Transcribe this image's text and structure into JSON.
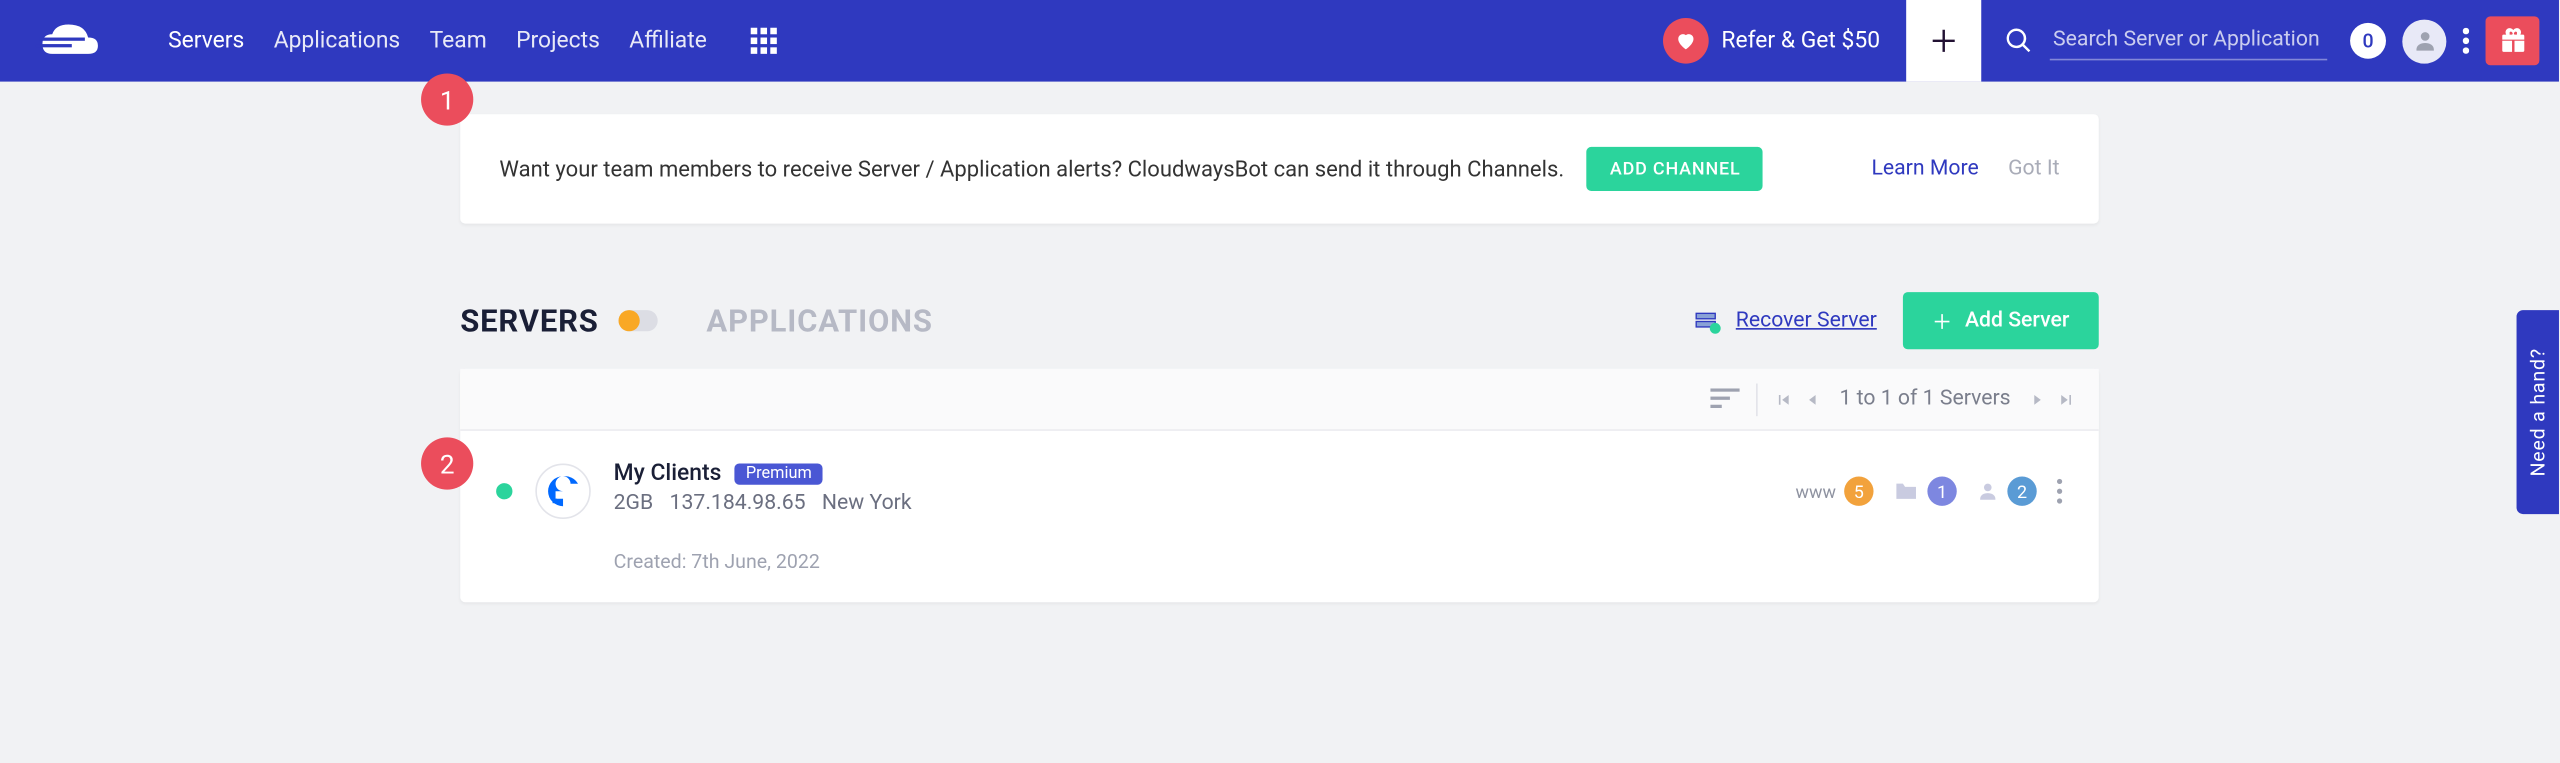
{
  "nav": {
    "items": [
      "Servers",
      "Applications",
      "Team",
      "Projects",
      "Affiliate"
    ],
    "active_index": 0
  },
  "topbar": {
    "refer_label": "Refer & Get $50",
    "search_placeholder": "Search Server or Application",
    "notif_count": "0"
  },
  "steps": {
    "one": "1",
    "two": "2"
  },
  "banner": {
    "text": "Want your team members to receive Server / Application alerts? CloudwaysBot can send it through Channels.",
    "add_channel": "ADD CHANNEL",
    "learn_more": "Learn More",
    "got_it": "Got It"
  },
  "section": {
    "servers_tab": "SERVERS",
    "apps_tab": "APPLICATIONS",
    "recover": "Recover Server",
    "add_server": "Add Server"
  },
  "list": {
    "pager_label": "1 to 1 of 1 Servers"
  },
  "server": {
    "name": "My Clients",
    "badge": "Premium",
    "size": "2GB",
    "ip": "137.184.98.65",
    "region": "New York",
    "created": "Created: 7th June, 2022",
    "stats": {
      "www_label": "www",
      "www_count": "5",
      "proj_count": "1",
      "team_count": "2"
    }
  },
  "help_tab": "Need a hand?"
}
